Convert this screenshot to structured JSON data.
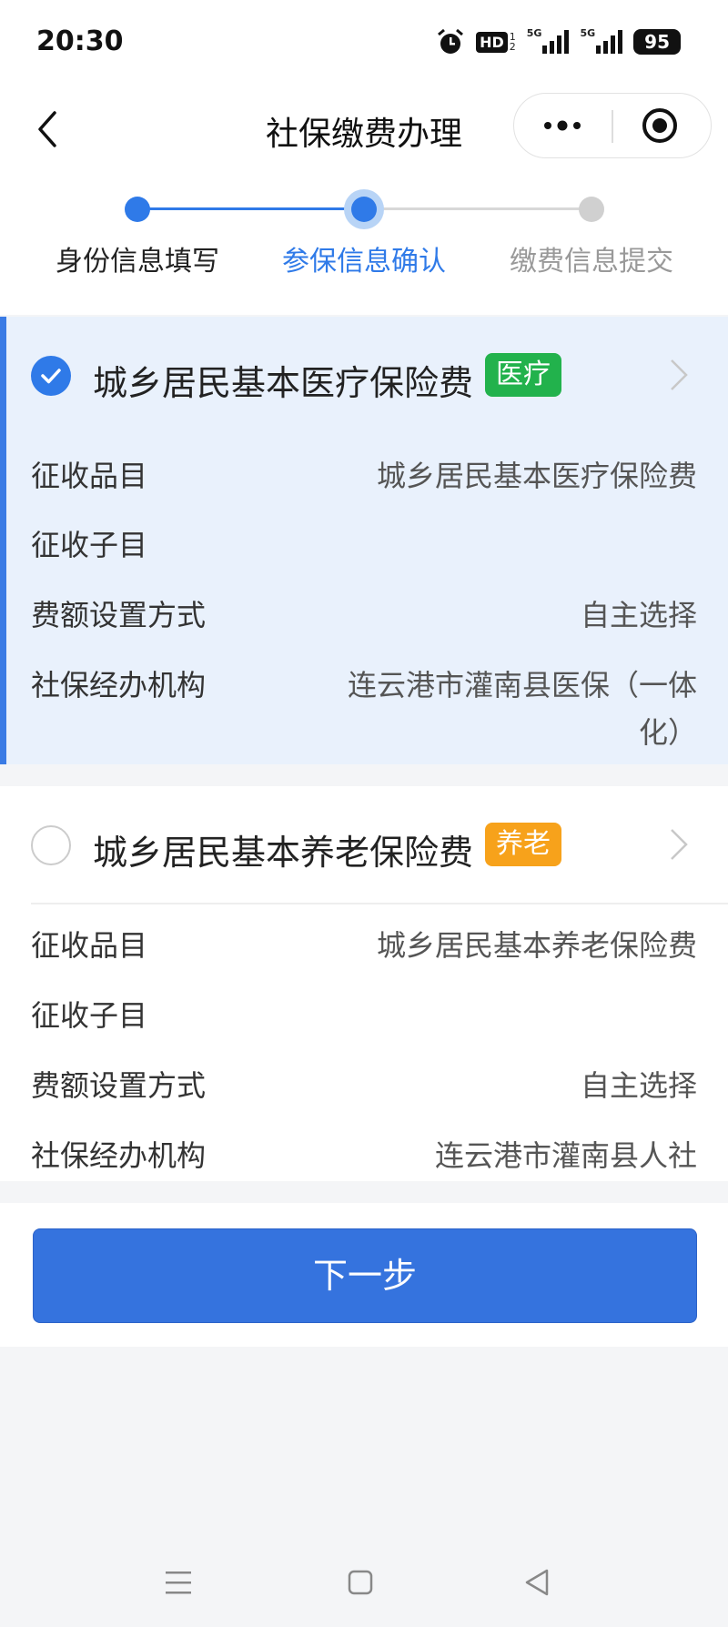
{
  "status_bar": {
    "time": "20:30",
    "hd": "HD",
    "hd_sub": "1\n2",
    "net1": "5G",
    "net2": "5G",
    "battery": "95"
  },
  "nav": {
    "title": "社保缴费办理"
  },
  "steps": [
    {
      "label": "身份信息填写",
      "state": "done"
    },
    {
      "label": "参保信息确认",
      "state": "active"
    },
    {
      "label": "缴费信息提交",
      "state": "pending"
    }
  ],
  "colors": {
    "accent": "#2f7ae8",
    "active_step_text": "#2f7ae8",
    "inactive_text": "#999999",
    "tag_medical": "#22b24c",
    "tag_pension": "#f7a21b",
    "button": "#3573de"
  },
  "items": [
    {
      "title": "城乡居民基本医疗保险费",
      "tag": "医疗",
      "selected": true,
      "rows": [
        {
          "label": "征收品目",
          "value": "城乡居民基本医疗保险费"
        },
        {
          "label": "征收子目",
          "value": ""
        },
        {
          "label": "费额设置方式",
          "value": "自主选择"
        },
        {
          "label": "社保经办机构",
          "value": "连云港市灌南县医保（一体",
          "value_line2": "化）"
        }
      ]
    },
    {
      "title": "城乡居民基本养老保险费",
      "tag": "养老",
      "selected": false,
      "rows": [
        {
          "label": "征收品目",
          "value": "城乡居民基本养老保险费"
        },
        {
          "label": "征收子目",
          "value": ""
        },
        {
          "label": "费额设置方式",
          "value": "自主选择"
        },
        {
          "label": "社保经办机构",
          "value": "连云港市灌南县人社"
        }
      ]
    }
  ],
  "next_button": "下一步",
  "icons": {
    "back": "chevron-left-icon",
    "more": "more-dots-icon",
    "close": "target-icon",
    "check": "check-icon",
    "arrow": "chevron-right-icon"
  }
}
